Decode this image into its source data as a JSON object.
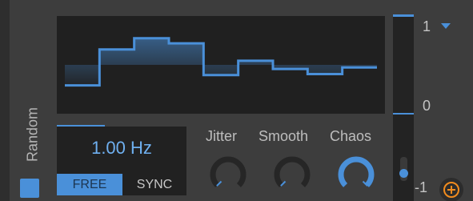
{
  "module": {
    "title": "Random",
    "enabled": true,
    "accent_color": "#4a90d9"
  },
  "waveform": {
    "steps": [
      -0.4,
      0.3,
      0.52,
      0.42,
      -0.2,
      0.08,
      -0.08,
      -0.18,
      -0.05
    ]
  },
  "rate": {
    "value": "1.00 Hz",
    "mode_buttons": [
      {
        "label": "FREE",
        "active": true
      },
      {
        "label": "SYNC",
        "active": false
      }
    ]
  },
  "knobs": [
    {
      "label": "Jitter",
      "value": 0.0
    },
    {
      "label": "Smooth",
      "value": 0.0
    },
    {
      "label": "Chaos",
      "value": 1.0
    }
  ],
  "depth": {
    "max_label": "1",
    "mid_label": "0",
    "min_label": "-1",
    "dropdown_icon": "triangle-down-icon"
  },
  "add_modulation": {
    "icon": "plus-circle-icon",
    "color": "#f28c1e"
  }
}
